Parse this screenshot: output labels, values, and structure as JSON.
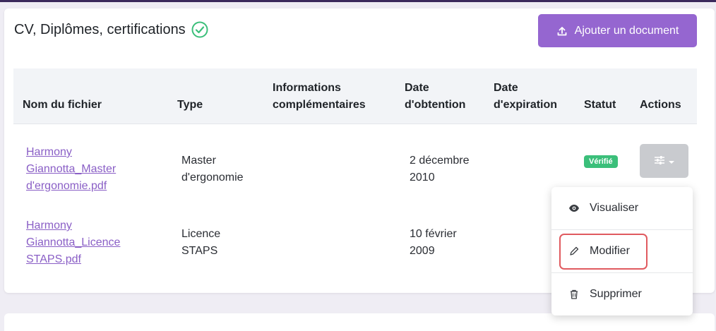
{
  "section": {
    "title": "CV, Diplômes, certifications",
    "add_button_label": "Ajouter un document"
  },
  "table": {
    "headers": {
      "filename": "Nom du fichier",
      "type": "Type",
      "info_line1": "Informations",
      "info_line2": "complémentaires",
      "date_obtained_line1": "Date",
      "date_obtained_line2": "d'obtention",
      "date_expiry_line1": "Date",
      "date_expiry_line2": "d'expiration",
      "status": "Statut",
      "actions": "Actions"
    },
    "rows": [
      {
        "filename_lines": [
          "Harmony",
          "Giannotta_Master",
          "d'ergonomie.pdf"
        ],
        "type_lines": [
          "Master",
          "d'ergonomie"
        ],
        "date_lines": [
          "2 décembre",
          "2010"
        ],
        "status": "Vérifié"
      },
      {
        "filename_lines": [
          "Harmony",
          "Giannotta_Licence",
          "STAPS.pdf"
        ],
        "type_lines": [
          "Licence",
          "STAPS"
        ],
        "date_lines": [
          "10 février",
          "2009"
        ]
      }
    ]
  },
  "menu": {
    "view_label": "Visualiser",
    "edit_label": "Modifier",
    "delete_label": "Supprimer"
  },
  "colors": {
    "accent": "#9566d0",
    "link": "#8a5fc6",
    "success": "#3bbf7a",
    "highlight": "#e05a5f"
  }
}
